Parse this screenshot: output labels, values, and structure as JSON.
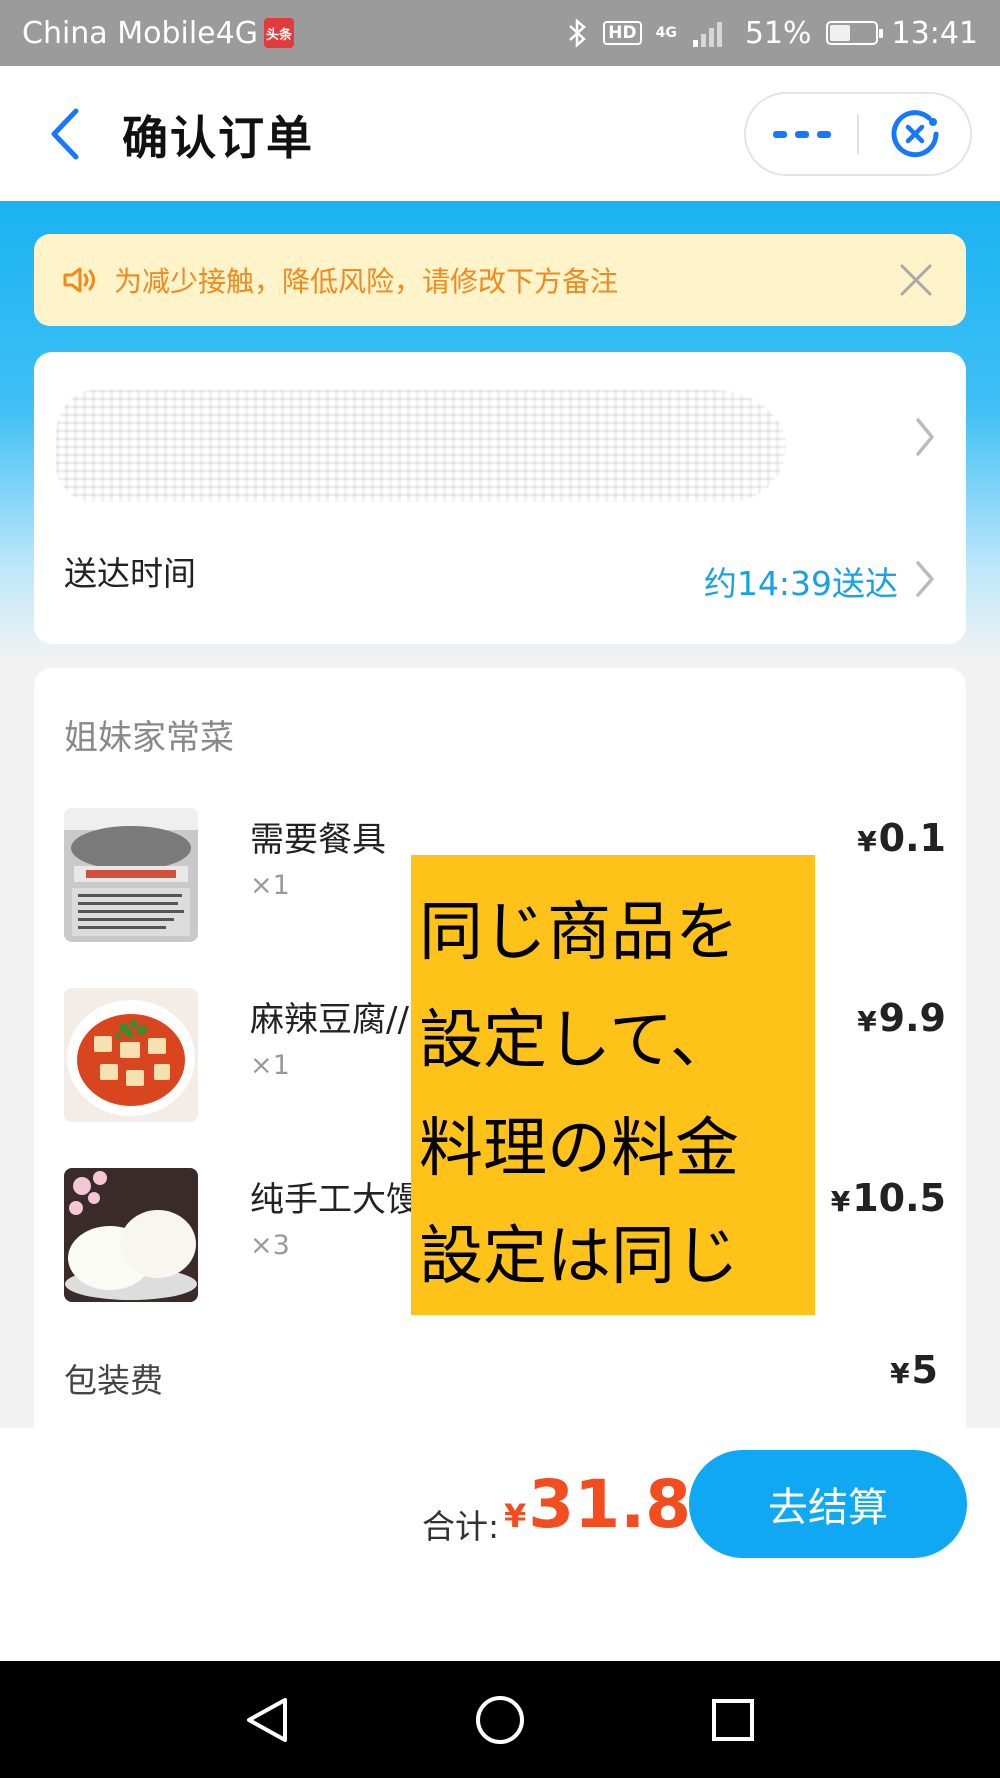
{
  "status_bar": {
    "carrier": "China Mobile4G",
    "app_badge": "头条",
    "hd": "HD",
    "network": "4G",
    "battery_percent": "51%",
    "battery_level": 0.51,
    "time": "13:41"
  },
  "header": {
    "title": "确认订单",
    "back_icon": "chevron-left-icon",
    "more_icon": "more-icon",
    "close_icon": "close-circle-icon"
  },
  "notice": {
    "text": "为减少接触，降低风险，请修改下方备注",
    "icon": "speaker-icon",
    "close_icon": "close-icon"
  },
  "address": {
    "redacted": true
  },
  "delivery": {
    "label": "送达时间",
    "value": "约14:39送达"
  },
  "shop": {
    "name": "姐妹家常菜"
  },
  "items": [
    {
      "name": "需要餐具",
      "qty": "×1",
      "currency": "¥",
      "price": "0.1"
    },
    {
      "name": "麻辣豆腐//",
      "qty": "×1",
      "currency": "¥",
      "price": "9.9"
    },
    {
      "name": "纯手工大馒头",
      "qty": "×3",
      "currency": "¥",
      "price": "10.5"
    }
  ],
  "packaging": {
    "label": "包装费",
    "currency": "¥",
    "price": "5"
  },
  "annotation": {
    "lines": [
      "同じ商品を",
      "設定して、",
      "料理の料金",
      "設定は同じ"
    ],
    "color": "#fec219"
  },
  "checkout": {
    "total_label": "合计:",
    "currency": "¥",
    "total": "31.8",
    "button_label": "去结算"
  },
  "colors": {
    "accent": "#10a8f2",
    "price_red": "#f24c1f",
    "notice_bg": "#fff4c9",
    "notice_text": "#f08a1e"
  }
}
